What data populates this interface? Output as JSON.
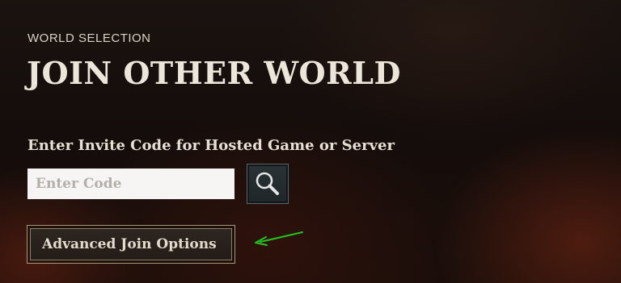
{
  "header": {
    "section_label": "WORLD SELECTION",
    "title": "JOIN OTHER WORLD"
  },
  "invite": {
    "label": "Enter Invite Code for Hosted Game or Server",
    "input_placeholder": "Enter Code",
    "input_value": "",
    "search_icon": "search-icon"
  },
  "advanced": {
    "button_label": "Advanced Join Options"
  },
  "annotation": {
    "arrow_icon": "arrow-icon",
    "arrow_color": "#22c41e"
  },
  "colors": {
    "accent_border": "#a69a7a",
    "search_button_border": "#59656a"
  }
}
